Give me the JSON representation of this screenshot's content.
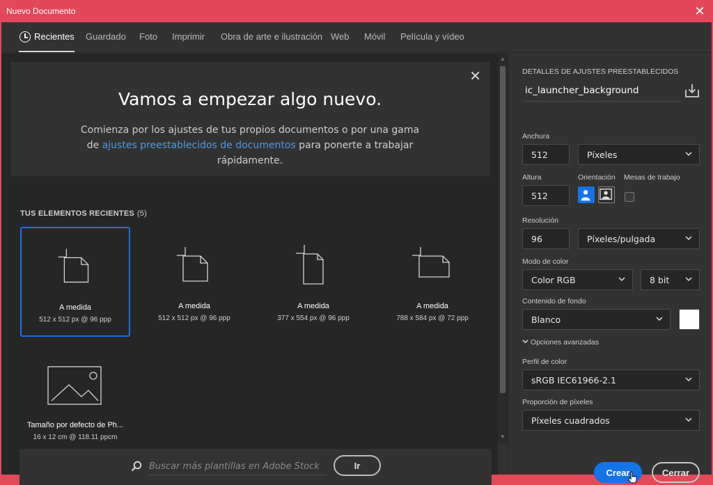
{
  "window": {
    "title": "Nuevo Documento"
  },
  "tabs": [
    {
      "label": "Recientes"
    },
    {
      "label": "Guardado"
    },
    {
      "label": "Foto"
    },
    {
      "label": "Imprimir"
    },
    {
      "label": "Obra de arte e ilustración"
    },
    {
      "label": "Web"
    },
    {
      "label": "Móvil"
    },
    {
      "label": "Película y vídeo"
    }
  ],
  "hero": {
    "title": "Vamos a empezar algo nuevo.",
    "text_before": "Comienza por los ajustes de tus propios documentos o por una gama de ",
    "link": "ajustes preestablecidos de documentos",
    "text_after": " para ponerte a trabajar rápidamente."
  },
  "recent": {
    "title": "TUS ELEMENTOS RECIENTES",
    "count": "(5)",
    "items": [
      {
        "name": "A medida",
        "size": "512 x 512 px @ 96 ppp"
      },
      {
        "name": "A medida",
        "size": "512 x 512 px @ 96 ppp"
      },
      {
        "name": "A medida",
        "size": "377 x 554 px @ 96 ppp"
      },
      {
        "name": "A medida",
        "size": "788 x 584 px @ 72 ppp"
      },
      {
        "name": "Tamaño por defecto de Ph...",
        "size": "16 x 12 cm @ 118.11 ppcm"
      }
    ]
  },
  "search": {
    "placeholder": "Buscar más plantillas en Adobe Stock",
    "button": "Ir"
  },
  "details": {
    "heading": "DETALLES DE AJUSTES PREESTABLECIDOS",
    "preset_name": "ic_launcher_background",
    "width_label": "Anchura",
    "width_value": "512",
    "width_unit": "Píxeles",
    "height_label": "Altura",
    "height_value": "512",
    "orientation_label": "Orientación",
    "artboards_label": "Mesas de trabajo",
    "resolution_label": "Resolución",
    "resolution_value": "96",
    "resolution_unit": "Píxeles/pulgada",
    "color_mode_label": "Modo de color",
    "color_mode": "Color RGB",
    "bit_depth": "8 bit",
    "background_label": "Contenido de fondo",
    "background": "Blanco",
    "background_swatch": "#ffffff",
    "advanced": "Opciones avanzadas",
    "color_profile_label": "Perfil de color",
    "color_profile": "sRGB IEC61966-2.1",
    "pixel_ratio_label": "Proporción de píxeles",
    "pixel_ratio": "Píxeles cuadrados"
  },
  "buttons": {
    "create": "Crear",
    "close": "Cerrar"
  },
  "colors": {
    "accent": "#1473e6",
    "titlebar": "#e2485a",
    "link": "#4a9bea"
  }
}
